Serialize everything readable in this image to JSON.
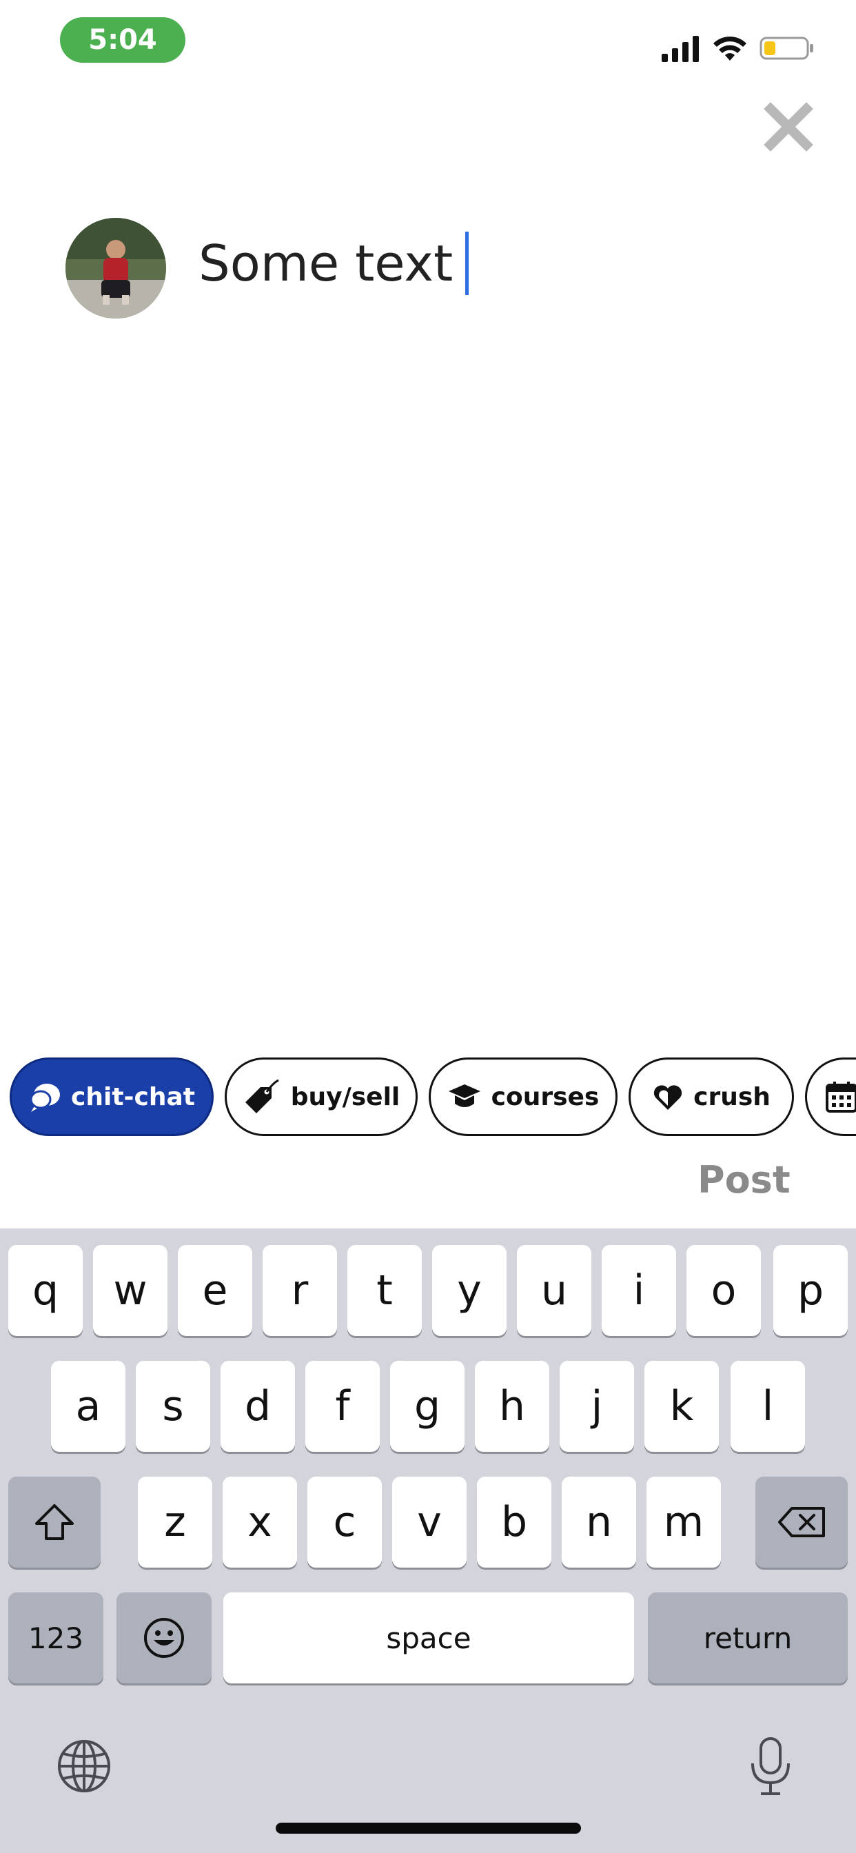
{
  "status_bar": {
    "time": "5:04",
    "colors": {
      "time_pill": "#4caf50",
      "battery_level": "#f5c518"
    }
  },
  "composer": {
    "text": "Some text"
  },
  "categories": [
    {
      "label": "chit-chat",
      "icon": "chat-bubbles-icon",
      "selected": true
    },
    {
      "label": "buy/sell",
      "icon": "price-tag-icon",
      "selected": false
    },
    {
      "label": "courses",
      "icon": "graduation-cap-icon",
      "selected": false
    },
    {
      "label": "crush",
      "icon": "heart-icon",
      "selected": false
    },
    {
      "label": "",
      "icon": "calendar-icon",
      "selected": false
    }
  ],
  "post_label": "Post",
  "keyboard": {
    "row1": [
      "q",
      "w",
      "e",
      "r",
      "t",
      "y",
      "u",
      "i",
      "o",
      "p"
    ],
    "row2": [
      "a",
      "s",
      "d",
      "f",
      "g",
      "h",
      "j",
      "k",
      "l"
    ],
    "row3": [
      "z",
      "x",
      "c",
      "v",
      "b",
      "n",
      "m"
    ],
    "numbers": "123",
    "space": "space",
    "return": "return"
  },
  "accent_colors": {
    "selected_chip": "#1b3fa8",
    "caret": "#2f6fe3"
  }
}
